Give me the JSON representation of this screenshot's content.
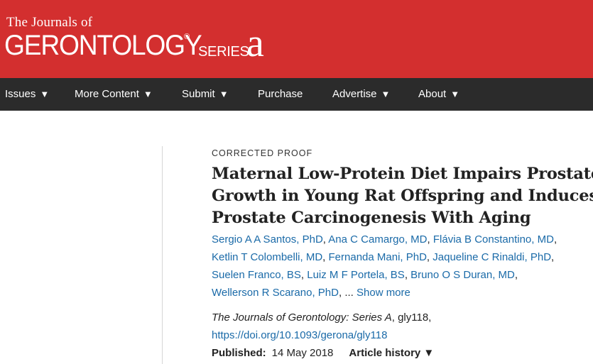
{
  "brand": {
    "small": "The Journals of",
    "main": "GERONTOLOGY",
    "reg": "®",
    "series": "SERIES",
    "letter": "a",
    "color": "#d32f2f"
  },
  "nav": {
    "items": [
      {
        "label": "Issues",
        "caret": "▼"
      },
      {
        "label": "More Content",
        "caret": "▼"
      },
      {
        "label": "Submit",
        "caret": "▼"
      },
      {
        "label": "Purchase",
        "caret": ""
      },
      {
        "label": "Advertise",
        "caret": "▼"
      },
      {
        "label": "About",
        "caret": "▼"
      }
    ]
  },
  "article": {
    "kicker": "CORRECTED PROOF",
    "title_lines": [
      "Maternal Low-Protein Diet Impairs Prostate",
      "Growth in Young Rat Offspring and Induces",
      "Prostate Carcinogenesis With Aging"
    ],
    "authors": [
      "Sergio A A Santos, PhD",
      "Ana C Camargo, MD",
      "Flávia B Constantino, MD",
      "Ketlin T Colombelli, MD",
      "Fernanda Mani, PhD",
      "Jaqueline C Rinaldi, PhD",
      "Suelen Franco, BS",
      "Luiz M F Portela, BS",
      "Bruno O S Duran, MD",
      "Wellerson R Scarano, PhD"
    ],
    "ellipsis": "...",
    "show_more": "Show more",
    "citation": {
      "journal": "The Journals of Gerontology: Series A",
      "id": ", gly118,",
      "doi": "https://doi.org/10.1093/gerona/gly118"
    },
    "published_label": "Published:",
    "published_date": "14 May 2018",
    "history_label": "Article history ▼"
  },
  "colors": {
    "link": "#1a6aa8",
    "navbar": "#2b2b2b"
  }
}
